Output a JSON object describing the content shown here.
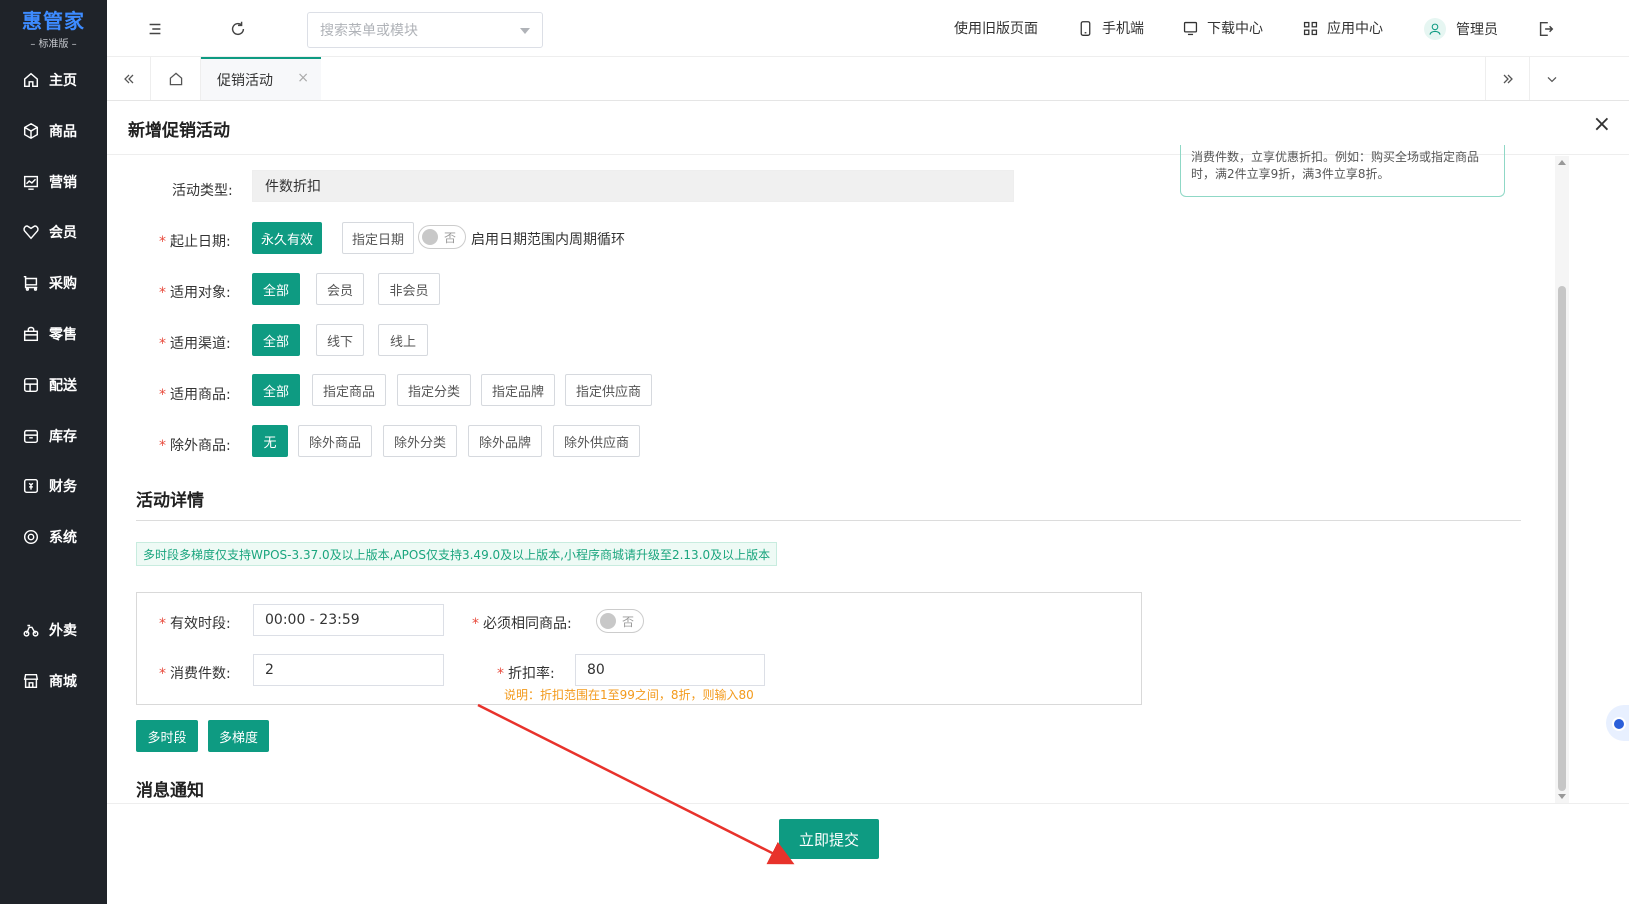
{
  "brand": {
    "name": "惠管家",
    "edition": "– 标准版 –"
  },
  "sidebar": {
    "items": [
      {
        "label": "主页",
        "icon": "home-icon"
      },
      {
        "label": "商品",
        "icon": "box-icon"
      },
      {
        "label": "营销",
        "icon": "chart-icon"
      },
      {
        "label": "会员",
        "icon": "heart-icon"
      },
      {
        "label": "采购",
        "icon": "cart-icon"
      },
      {
        "label": "零售",
        "icon": "bag-icon"
      },
      {
        "label": "配送",
        "icon": "delivery-icon"
      },
      {
        "label": "库存",
        "icon": "inventory-icon"
      },
      {
        "label": "财务",
        "icon": "finance-icon"
      },
      {
        "label": "系统",
        "icon": "settings-icon"
      },
      {
        "label": "外卖",
        "icon": "scooter-icon"
      },
      {
        "label": "商城",
        "icon": "store-icon"
      }
    ]
  },
  "header": {
    "search_placeholder": "搜索菜单或模块",
    "old_version": "使用旧版页面",
    "mobile": "手机端",
    "download": "下载中心",
    "apps": "应用中心",
    "user": "管理员"
  },
  "tabs": {
    "active": "促销活动",
    "close": "×"
  },
  "panel": {
    "title": "新增促销活动",
    "close": "×",
    "tip": "消费件数，立享优惠折扣。例如：购买全场或指定商品时，满2件立享9折，满3件立享8折。",
    "activity_type": {
      "label": "活动类型:",
      "value": "件数折扣"
    },
    "date": {
      "label": "起止日期:",
      "options": [
        "永久有效",
        "指定日期"
      ],
      "switch_text": "否",
      "cycle_label": "启用日期范围内周期循环"
    },
    "target": {
      "label": "适用对象:",
      "options": [
        "全部",
        "会员",
        "非会员"
      ]
    },
    "channel": {
      "label": "适用渠道:",
      "options": [
        "全部",
        "线下",
        "线上"
      ]
    },
    "goods": {
      "label": "适用商品:",
      "options": [
        "全部",
        "指定商品",
        "指定分类",
        "指定品牌",
        "指定供应商"
      ]
    },
    "exclude": {
      "label": "除外商品:",
      "options": [
        "无",
        "除外商品",
        "除外分类",
        "除外品牌",
        "除外供应商"
      ]
    },
    "detail_title": "活动详情",
    "notice": "多时段多梯度仅支持WPOS-3.37.0及以上版本,APOS仅支持3.49.0及以上版本,小程序商城请升级至2.13.0及以上版本",
    "period": {
      "label": "有效时段:",
      "value": "00:00 - 23:59"
    },
    "same_goods": {
      "label": "必须相同商品:",
      "switch_text": "否"
    },
    "qty": {
      "label": "消费件数:",
      "value": "2"
    },
    "rate": {
      "label": "折扣率:",
      "value": "80"
    },
    "rate_hint": "说明：折扣范围在1至99之间，8折，则输入80",
    "multi_period": "多时段",
    "multi_tier": "多梯度",
    "notify_title": "消息通知",
    "submit": "立即提交"
  },
  "colors": {
    "primary": "#0e9b82",
    "sidebar": "#1f2329",
    "required": "#e84a3c",
    "hint": "#f39a1c",
    "annotation_arrow": "#e8322b"
  }
}
